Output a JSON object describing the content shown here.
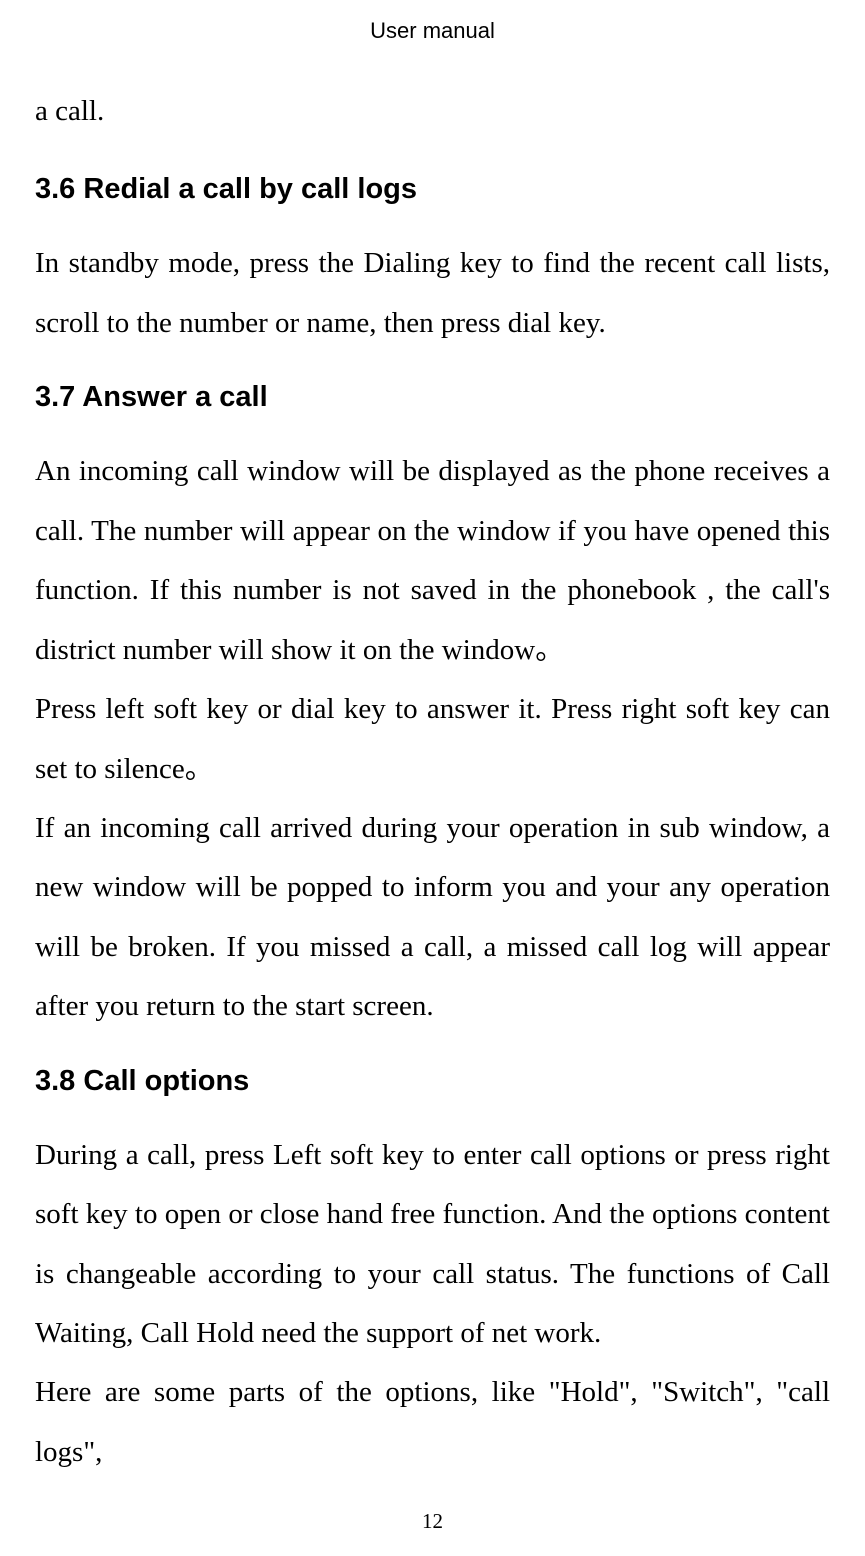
{
  "header": "User manual",
  "continuation": "a call.",
  "sections": [
    {
      "heading": "3.6 Redial a call by call logs",
      "paragraphs": [
        "In standby mode, press the Dialing key to find the recent call lists, scroll to the number or name, then press dial key."
      ]
    },
    {
      "heading": "3.7 Answer a call",
      "paragraphs": [
        "An incoming call window will be displayed as the phone receives a call. The number will appear on the window if you have opened this function. If this number is not saved in the phonebook , the call's district number will show it on the window。",
        "Press left soft key or dial key to answer it. Press right soft key can set to silence。",
        "If an incoming call arrived during your operation in sub window, a new window will be popped to inform you and your any operation will be broken. If you missed a call, a missed call log will appear after you return to the start screen."
      ]
    },
    {
      "heading": "3.8 Call options",
      "paragraphs": [
        "During a call, press Left soft key to enter call options or press right soft key to open or close hand free function. And the options content is changeable according to your call status. The functions of Call Waiting, Call Hold need the support of net work.",
        "Here are some parts of the options, like \"Hold\", \"Switch\", \"call logs\","
      ]
    }
  ],
  "page_number": "12"
}
